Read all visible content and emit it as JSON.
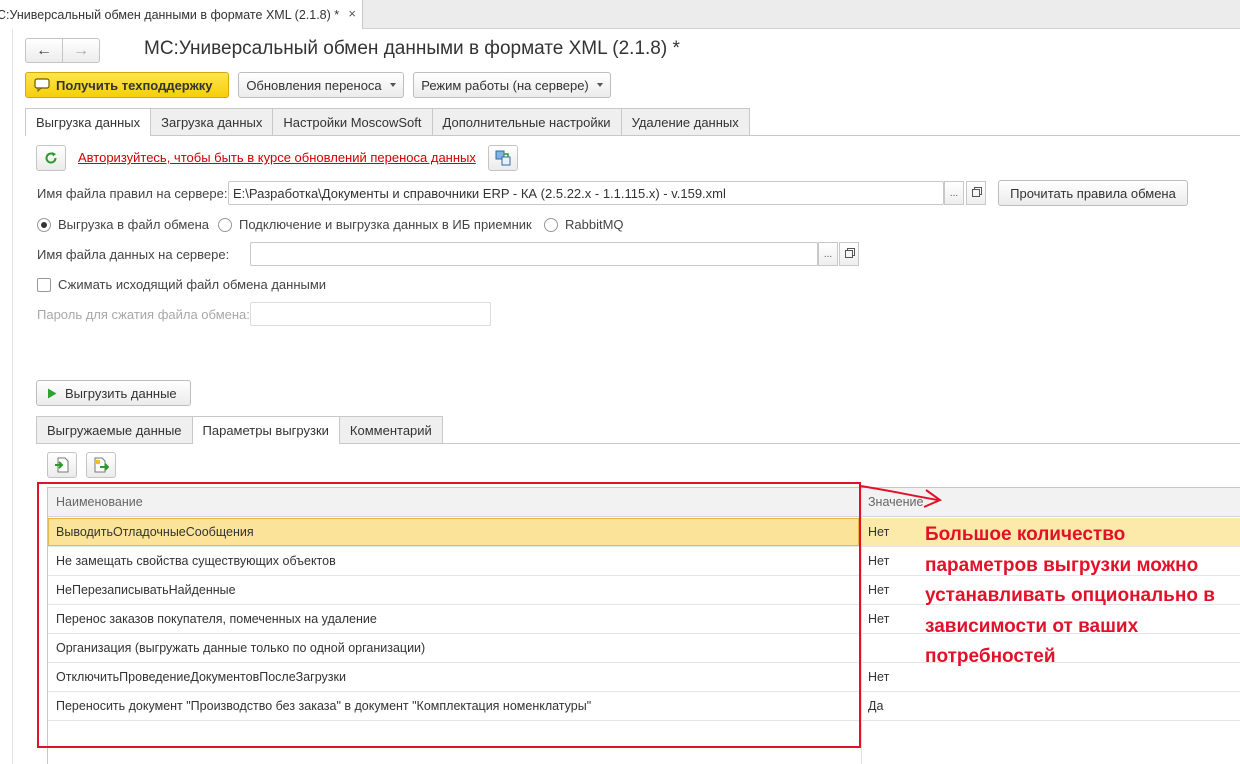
{
  "window": {
    "tab_title": "С:Универсальный обмен данными в формате XML (2.1.8) *",
    "close_glyph": "×"
  },
  "header": {
    "title": "МС:Универсальный обмен данными в формате XML (2.1.8) *"
  },
  "toolbar": {
    "support_label": "Получить техподдержку",
    "updates_label": "Обновления переноса",
    "mode_label": "Режим работы (на сервере)"
  },
  "main_tabs": [
    {
      "label": "Выгрузка данных",
      "active": true
    },
    {
      "label": "Загрузка данных",
      "active": false
    },
    {
      "label": "Настройки MoscowSoft",
      "active": false
    },
    {
      "label": "Дополнительные настройки",
      "active": false
    },
    {
      "label": "Удаление данных",
      "active": false
    }
  ],
  "export": {
    "auth_link": "Авторизуйтесь, чтобы быть в курсе обновлений переноса данных",
    "rules_file_label": "Имя файла правил на сервере:",
    "rules_file_value": "E:\\Разработка\\Документы и справочники ERP - КА (2.5.22.x - 1.1.115.x) - v.159.xml",
    "read_rules_label": "Прочитать правила обмена",
    "radio_options": [
      {
        "label": "Выгрузка в файл обмена",
        "checked": true
      },
      {
        "label": "Подключение и выгрузка данных в ИБ приемник",
        "checked": false
      },
      {
        "label": "RabbitMQ",
        "checked": false
      }
    ],
    "data_file_label": "Имя файла данных на сервере:",
    "data_file_value": "",
    "compress_label": "Сжимать исходящий файл обмена данными",
    "compress_checked": false,
    "password_label": "Пароль для сжатия файла обмена:",
    "password_value": "",
    "export_button_label": "Выгрузить данные",
    "picker_glyph": "..."
  },
  "sub_tabs": [
    {
      "label": "Выгружаемые данные",
      "active": false
    },
    {
      "label": "Параметры выгрузки",
      "active": true
    },
    {
      "label": "Комментарий",
      "active": false
    }
  ],
  "params_table": {
    "columns": [
      "Наименование",
      "Значение"
    ],
    "rows": [
      {
        "name": "ВыводитьОтладочныеСообщения",
        "value": "Нет",
        "selected": true
      },
      {
        "name": "Не замещать свойства существующих объектов",
        "value": "Нет",
        "selected": false
      },
      {
        "name": "НеПерезаписыватьНайденные",
        "value": "Нет",
        "selected": false
      },
      {
        "name": "Перенос заказов покупателя, помеченных на удаление",
        "value": "Нет",
        "selected": false
      },
      {
        "name": "Организация (выгружать данные только по одной организации)",
        "value": "",
        "selected": false
      },
      {
        "name": "ОтключитьПроведениеДокументовПослеЗагрузки",
        "value": "Нет",
        "selected": false
      },
      {
        "name": "Переносить документ \"Производство без заказа\" в документ \"Комплектация номенклатуры\"",
        "value": "Да",
        "selected": false
      }
    ]
  },
  "annotation": {
    "text": "Большое количество параметров выгрузки можно устанавливать опционально в зависимости от ваших потребностей",
    "color": "#e2112a"
  },
  "colors": {
    "accent_yellow": "#f5cf0a",
    "link_red": "#d00000",
    "selected_row": "#fbe39a"
  }
}
